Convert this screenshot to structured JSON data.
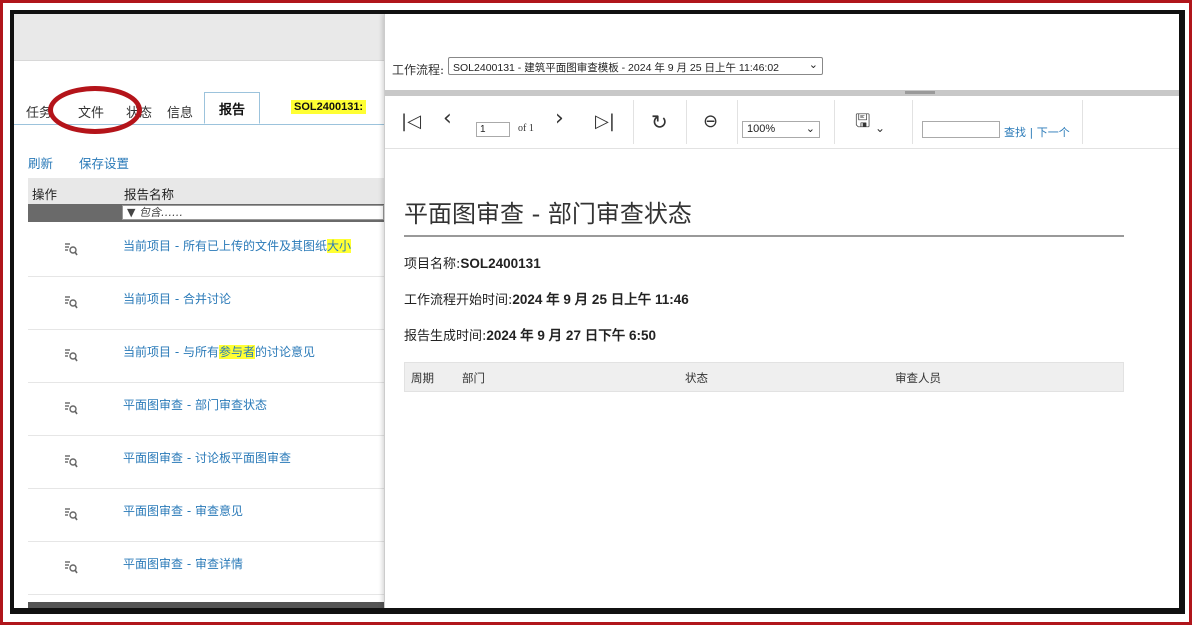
{
  "left": {
    "tabs": [
      "任务",
      "文件",
      "状态",
      "信息"
    ],
    "active_tab": "报告",
    "project_tab": "SOL2400131:",
    "actions": [
      "刷新",
      "保存设置"
    ],
    "columns": [
      "操作",
      "报告名称"
    ],
    "filter_placeholder": "包含……",
    "rows": [
      {
        "pre": "当前项目 - 所有已上传的文件及其图纸",
        "hl": "大小",
        "post": ""
      },
      {
        "pre": "当前项目 - 合并讨论",
        "hl": "",
        "post": ""
      },
      {
        "pre": "当前项目 - 与所有",
        "hl": "参与者",
        "post": "的讨论意见"
      },
      {
        "pre": "平面图审查 - 部门审查状态",
        "hl": "",
        "post": ""
      },
      {
        "pre": "平面图审查 - 讨论板平面图审查",
        "hl": "",
        "post": ""
      },
      {
        "pre": "平面图审查 - 审查意见",
        "hl": "",
        "post": ""
      },
      {
        "pre": "平面图审查 - 审查详情",
        "hl": "",
        "post": ""
      }
    ]
  },
  "right": {
    "workflow_label": "工作流程:",
    "workflow_value": "SOL2400131 - 建筑平面图审查模板 - 2024 年 9 月 25 日上午 11:46:02",
    "page_value": "1",
    "page_of": "of 1",
    "zoom_value": "100%",
    "find_link": "查找",
    "next_link": "下一个",
    "report_title": "平面图审查 - 部门审查状态",
    "meta": [
      {
        "label": "项目名称:",
        "value": "SOL2400131"
      },
      {
        "label": "工作流程开始时间:",
        "value": "2024 年 9 月 25 日上午 11:46"
      },
      {
        "label": "报告生成时间:",
        "value": "2024 年 9 月 27 日下午 6:50"
      }
    ],
    "grid_columns": [
      "周期",
      "部门",
      "状态",
      "审查人员"
    ]
  },
  "colors": {
    "accent_link": "#2a7ab8",
    "highlight": "#ffff33",
    "annotation": "#b4141a",
    "frame": "#b0151b"
  }
}
